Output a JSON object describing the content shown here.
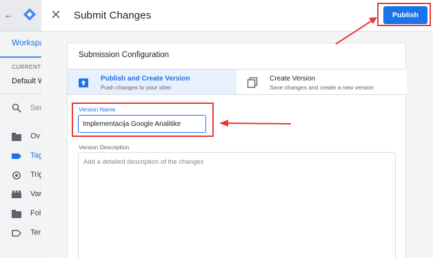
{
  "app": {
    "back_icon": "arrow-left-icon",
    "logo_icon": "tag-manager-logo-icon",
    "workspace_tab": "Workspa",
    "current_workspace_label": "CURRENT W",
    "current_workspace_value": "Default W",
    "search_placeholder": "Sea",
    "sidebar_items": [
      {
        "label": "Ov",
        "icon": "overview-folder-icon",
        "active": false
      },
      {
        "label": "Tag",
        "icon": "tag-icon",
        "active": true
      },
      {
        "label": "Trig",
        "icon": "trigger-icon",
        "active": false
      },
      {
        "label": "Var",
        "icon": "variables-icon",
        "active": false
      },
      {
        "label": "Fol",
        "icon": "folder-icon",
        "active": false
      },
      {
        "label": "Ter",
        "icon": "template-icon",
        "active": false
      }
    ]
  },
  "panel": {
    "close_icon": "close-icon",
    "title": "Submit Changes",
    "publish_label": "Publish",
    "card_title": "Submission Configuration",
    "options": [
      {
        "title": "Publish and Create Version",
        "subtitle": "Push changes to your sites",
        "icon": "publish-upload-icon",
        "selected": true
      },
      {
        "title": "Create Version",
        "subtitle": "Save changes and create a new version",
        "icon": "copy-version-icon",
        "selected": false
      }
    ],
    "version_name_label": "Version Name",
    "version_name_value": "Implementacija Google Analitike",
    "version_description_label": "Version Description",
    "version_description_placeholder": "Add a detailed description of the changes"
  },
  "colors": {
    "primary": "#1a73e8",
    "selected_bg": "#e8f0fe",
    "annotation_red": "#e53935"
  }
}
